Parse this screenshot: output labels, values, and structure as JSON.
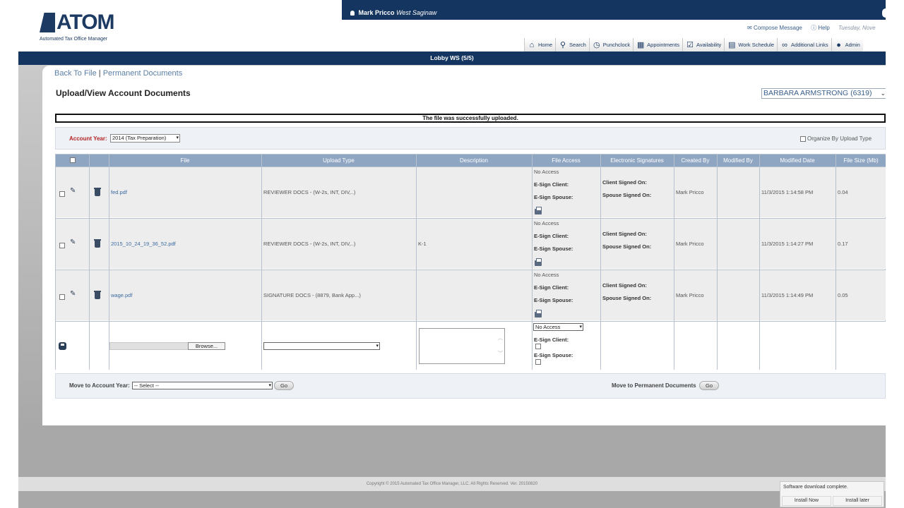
{
  "header": {
    "logo_word": "ATOM",
    "logo_sub": "Automated Tax Office Manager",
    "user_name": "Mark Pricco",
    "office": "West Saginaw",
    "compose_label": "Compose Message",
    "help_label": "Help",
    "date_text": "Tuesday, Nove"
  },
  "nav": [
    {
      "label": "Home",
      "icon": "home-icon"
    },
    {
      "label": "Search",
      "icon": "search-icon"
    },
    {
      "label": "Punchclock",
      "icon": "clock-icon"
    },
    {
      "label": "Appointments",
      "icon": "calendar-icon"
    },
    {
      "label": "Availability",
      "icon": "checkbox-icon"
    },
    {
      "label": "Work Schedule",
      "icon": "clipboard-icon"
    },
    {
      "label": "Additional Links",
      "icon": "link-icon"
    },
    {
      "label": "Admin",
      "icon": "user-icon"
    }
  ],
  "lobby": "Lobby WS (5/5)",
  "breadcrumb": {
    "back": "Back To File",
    "separator": "|",
    "permanent": "Permanent Documents"
  },
  "page_title": "Upload/View Account Documents",
  "client_select": "BARBARA ARMSTRONG (6319)",
  "success_message": "The file was successfully uploaded.",
  "filters": {
    "account_year_label": "Account Year:",
    "account_year_value": "2014 (Tax Preparation)",
    "organize_label": "Organize By Upload Type"
  },
  "table": {
    "headers": {
      "file": "File",
      "upload_type": "Upload Type",
      "description": "Description",
      "file_access": "File Access",
      "esig": "Electronic Signatures",
      "created_by": "Created By",
      "modified_by": "Modified By",
      "modified_date": "Modified Date",
      "file_size": "File Size (Mb)"
    },
    "labels": {
      "esign_client": "E-Sign Client:",
      "esign_spouse": "E-Sign Spouse:",
      "client_signed": "Client Signed On:",
      "spouse_signed": "Spouse Signed On:"
    },
    "rows": [
      {
        "file": "fed.pdf",
        "upload_type": "REVIEWER DOCS - (W-2s, INT, DIV,..)",
        "description": "",
        "access": "No Access",
        "created_by": "Mark Pricco",
        "modified_by": "",
        "modified_date": "11/3/2015 1:14:58 PM",
        "size": "0.04"
      },
      {
        "file": "2015_10_24_19_36_52.pdf",
        "upload_type": "REVIEWER DOCS - (W-2s, INT, DIV,..)",
        "description": "K-1",
        "access": "No Access",
        "created_by": "Mark Pricco",
        "modified_by": "",
        "modified_date": "11/3/2015 1:14:27 PM",
        "size": "0.17"
      },
      {
        "file": "wage.pdf",
        "upload_type": "SIGNATURE DOCS - (8879, Bank App...)",
        "description": "",
        "access": "No Access",
        "created_by": "Mark Pricco",
        "modified_by": "",
        "modified_date": "11/3/2015 1:14:49 PM",
        "size": "0.05"
      }
    ],
    "new_row": {
      "browse_label": "Browse...",
      "upload_type_value": "",
      "access_value": "No Access"
    }
  },
  "actions": {
    "move_year_label": "Move to Account Year:",
    "move_year_value": "-- Select --",
    "go_label": "Go",
    "move_perm_label": "Move to Permanent Documents"
  },
  "footer": "Copyright © 2015 Automated Tax Office Manager, LLC. All Rights Reserved. Ver. 20150820",
  "toast": {
    "message": "Software download complete.",
    "install_now": "Install Now",
    "install_later": "Install later"
  }
}
